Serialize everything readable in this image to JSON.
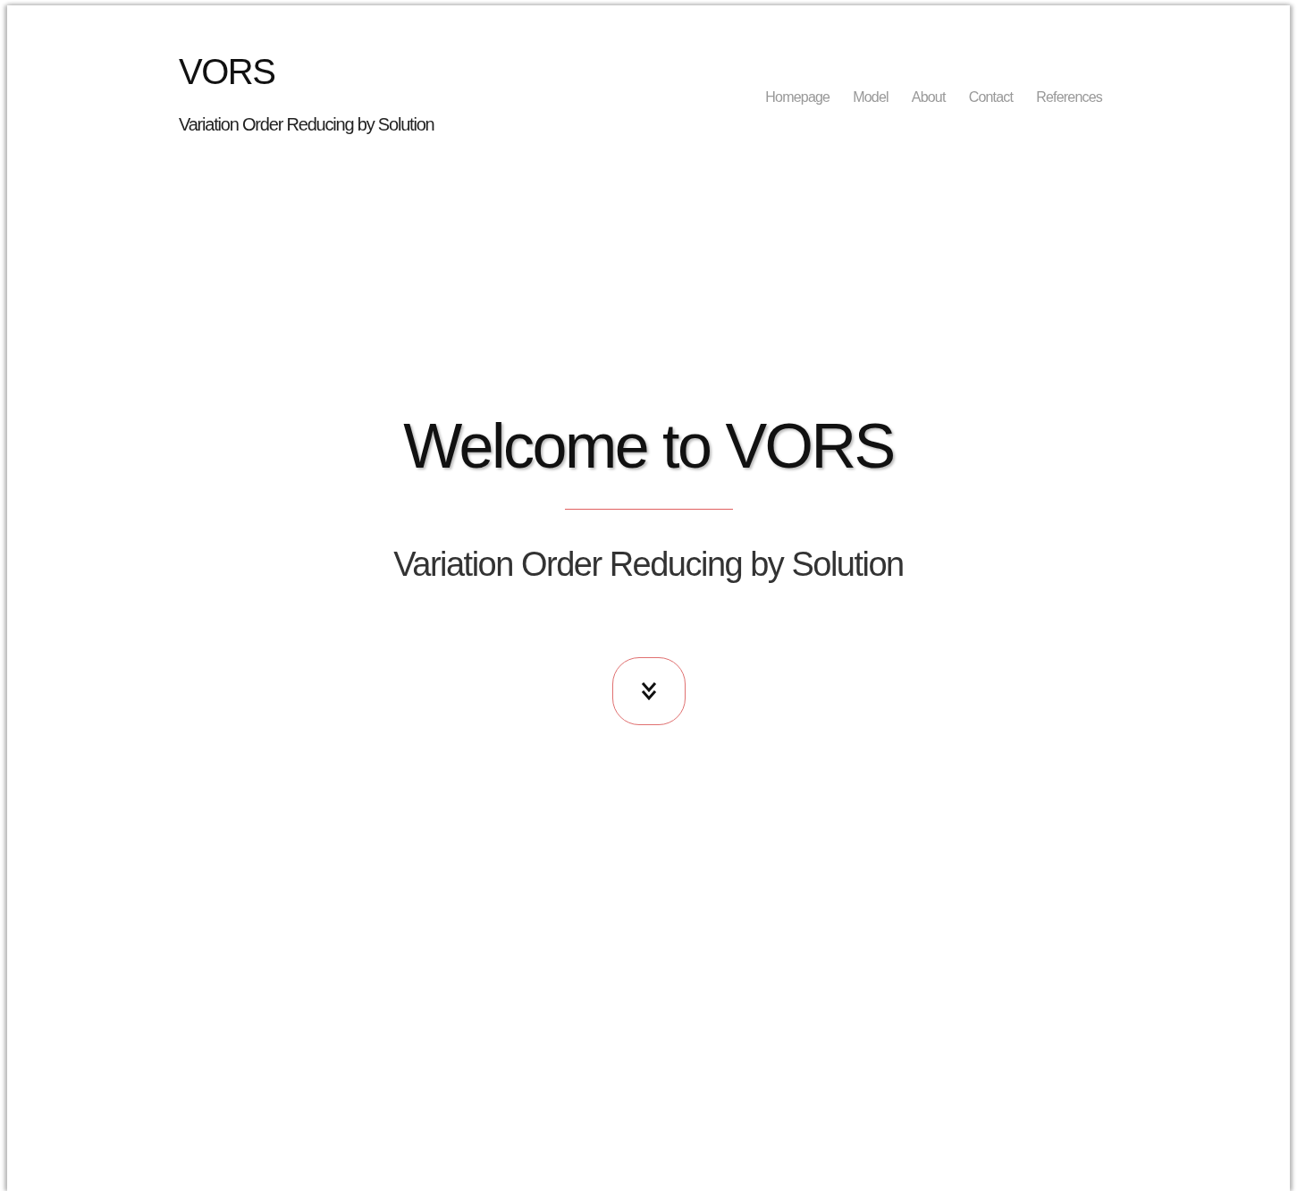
{
  "header": {
    "logo": "VORS",
    "tagline": "Variation Order Reducing by Solution"
  },
  "nav": [
    {
      "label": "Homepage"
    },
    {
      "label": "Model"
    },
    {
      "label": "About"
    },
    {
      "label": "Contact"
    },
    {
      "label": "References"
    }
  ],
  "hero": {
    "title": "Welcome to VORS",
    "subtitle": "Variation Order Reducing by Solution"
  }
}
